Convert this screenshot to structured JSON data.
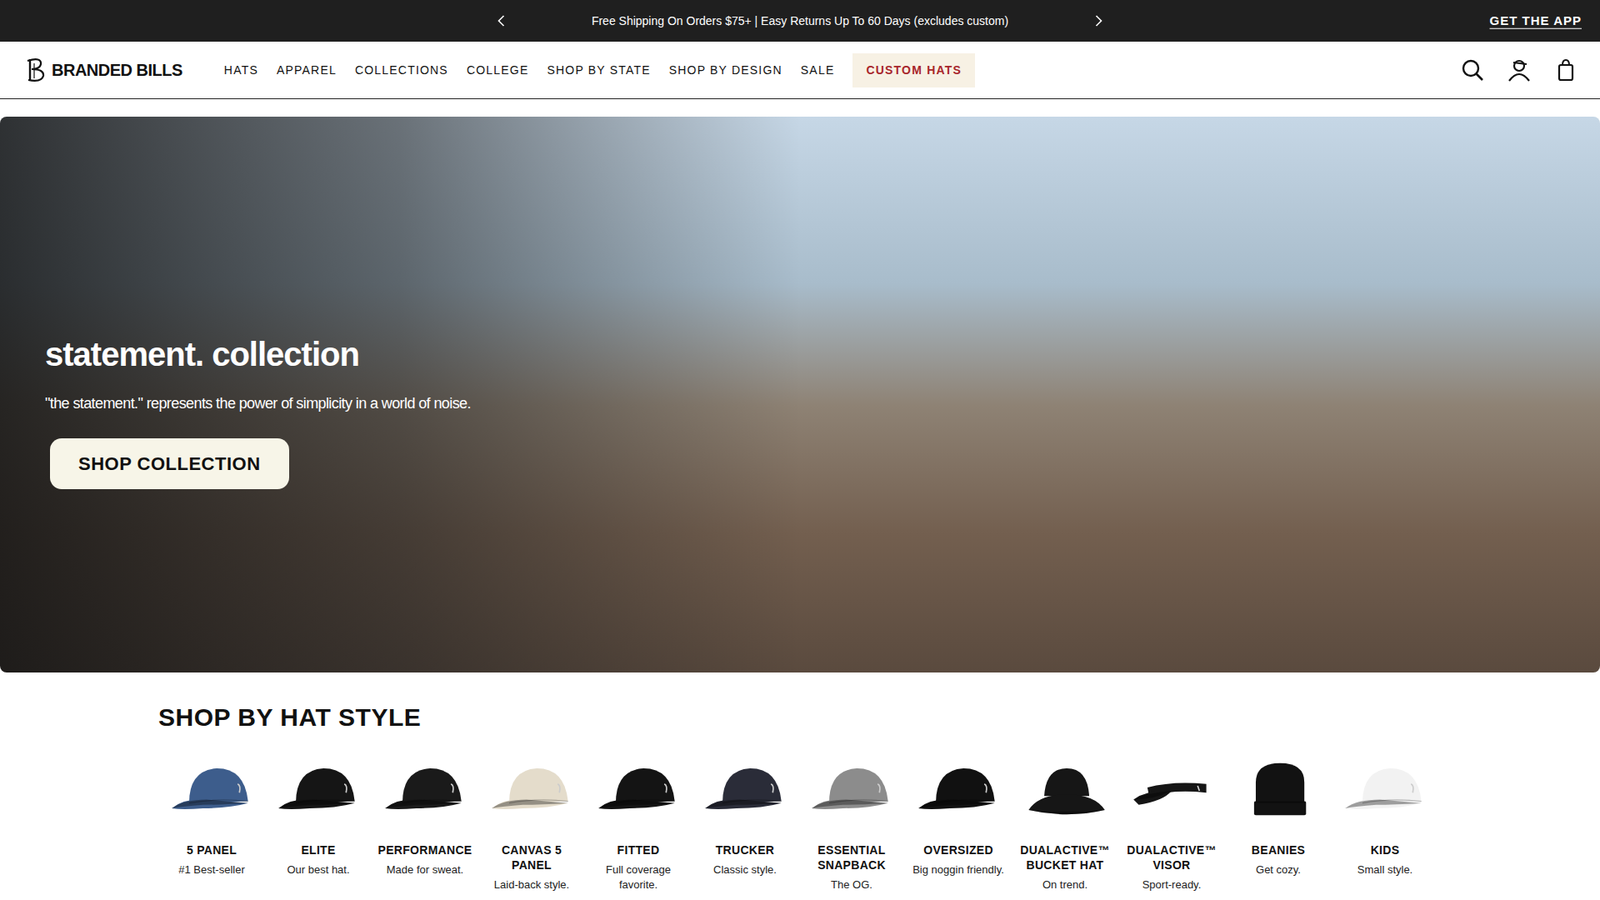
{
  "announcement": {
    "message": "Free Shipping On Orders $75+ | Easy Returns Up To 60 Days (excludes custom)",
    "app_link": "GET THE APP"
  },
  "brand": "BRANDED BILLS",
  "nav": [
    {
      "label": "HATS",
      "kind": "link"
    },
    {
      "label": "APPAREL",
      "kind": "link"
    },
    {
      "label": "COLLECTIONS",
      "kind": "link"
    },
    {
      "label": "COLLEGE",
      "kind": "link"
    },
    {
      "label": "SHOP BY STATE",
      "kind": "link"
    },
    {
      "label": "SHOP BY DESIGN",
      "kind": "link"
    },
    {
      "label": "SALE",
      "kind": "link"
    },
    {
      "label": "CUSTOM HATS",
      "kind": "highlight"
    }
  ],
  "hero": {
    "title": "statement. collection",
    "subtitle": "\"the statement.\" represents the power of simplicity in a world of noise.",
    "button": "SHOP COLLECTION"
  },
  "hat_styles": {
    "title": "SHOP BY HAT STYLE",
    "items": [
      {
        "name": "5 PANEL",
        "tagline": "#1 Best-seller",
        "kind": "cap",
        "color": "#3d5d8c"
      },
      {
        "name": "ELITE",
        "tagline": "Our best hat.",
        "kind": "cap",
        "color": "#151515"
      },
      {
        "name": "PERFORMANCE",
        "tagline": "Made for sweat.",
        "kind": "cap",
        "color": "#1a1a1a"
      },
      {
        "name": "CANVAS 5 PANEL",
        "tagline": "Laid-back style.",
        "kind": "cap",
        "color": "#e4dccb"
      },
      {
        "name": "FITTED",
        "tagline": "Full coverage favorite.",
        "kind": "cap",
        "color": "#141414"
      },
      {
        "name": "TRUCKER",
        "tagline": "Classic style.",
        "kind": "cap",
        "color": "#2a2c38"
      },
      {
        "name": "ESSENTIAL SNAPBACK",
        "tagline": "The OG.",
        "kind": "cap",
        "color": "#8c8c8c"
      },
      {
        "name": "OVERSIZED",
        "tagline": "Big noggin friendly.",
        "kind": "cap",
        "color": "#111111"
      },
      {
        "name": "DUALACTIVE™ BUCKET HAT",
        "tagline": "On trend.",
        "kind": "bucket",
        "color": "#161616"
      },
      {
        "name": "DUALACTIVE™ VISOR",
        "tagline": "Sport-ready.",
        "kind": "visor",
        "color": "#151515"
      },
      {
        "name": "BEANIES",
        "tagline": "Get cozy.",
        "kind": "beanie",
        "color": "#121212"
      },
      {
        "name": "KIDS",
        "tagline": "Small style.",
        "kind": "cap",
        "color": "#f2f2f2"
      }
    ]
  }
}
